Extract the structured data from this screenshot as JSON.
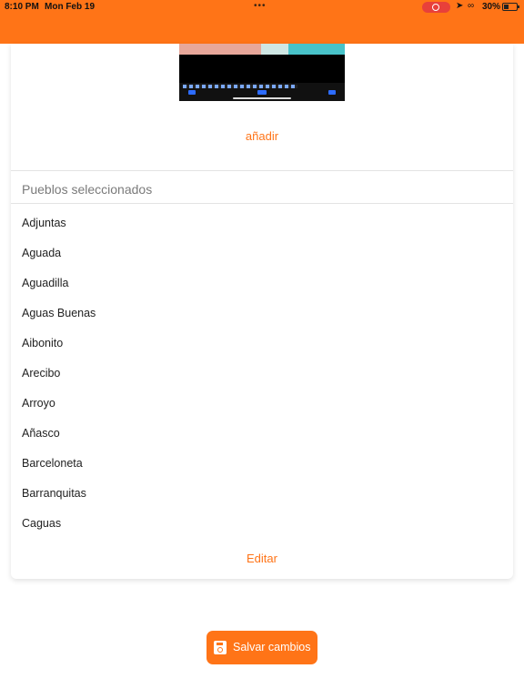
{
  "status_bar": {
    "time": "8:10 PM",
    "date": "Mon Feb 19",
    "battery": "30%"
  },
  "colors": {
    "accent": "#ff7417"
  },
  "photo_section": {
    "add_label": "añadir"
  },
  "towns_section": {
    "title": "Pueblos seleccionados",
    "items": [
      "Adjuntas",
      "Aguada",
      "Aguadilla",
      "Aguas Buenas",
      "Aibonito",
      "Arecibo",
      "Arroyo",
      "Añasco",
      "Barceloneta",
      "Barranquitas",
      "Caguas"
    ],
    "edit_label": "Editar"
  },
  "footer": {
    "save_label": "Salvar cambios"
  }
}
